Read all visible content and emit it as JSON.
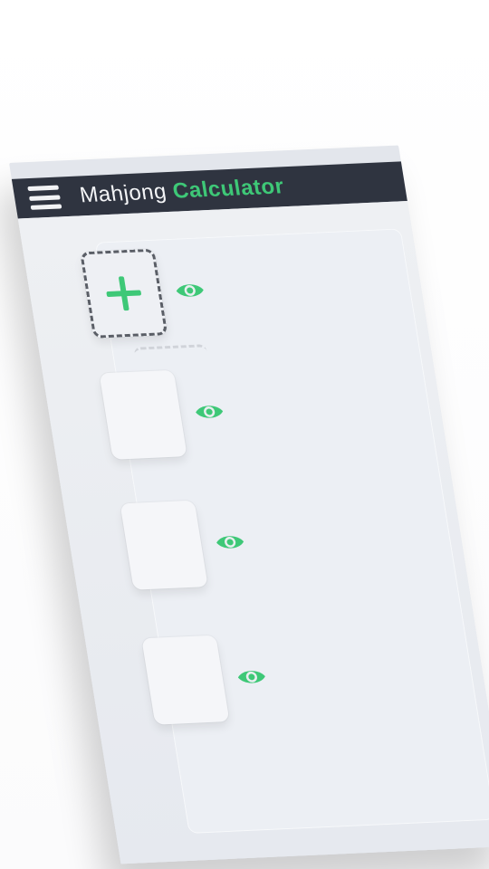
{
  "header": {
    "title_part1": "Mahjong",
    "title_part2": "Calculator",
    "menu_icon": "hamburger-menu-icon"
  },
  "tiles": [
    {
      "kind": "add",
      "icon": "plus-icon",
      "toggle_icon": "eye-icon"
    },
    {
      "kind": "empty",
      "toggle_icon": "eye-icon"
    },
    {
      "kind": "empty",
      "toggle_icon": "eye-icon"
    },
    {
      "kind": "empty",
      "toggle_icon": "eye-icon"
    }
  ],
  "colors": {
    "header_bg": "#2f3440",
    "accent": "#3ec877",
    "panel_bg": "#e3e6ec"
  }
}
